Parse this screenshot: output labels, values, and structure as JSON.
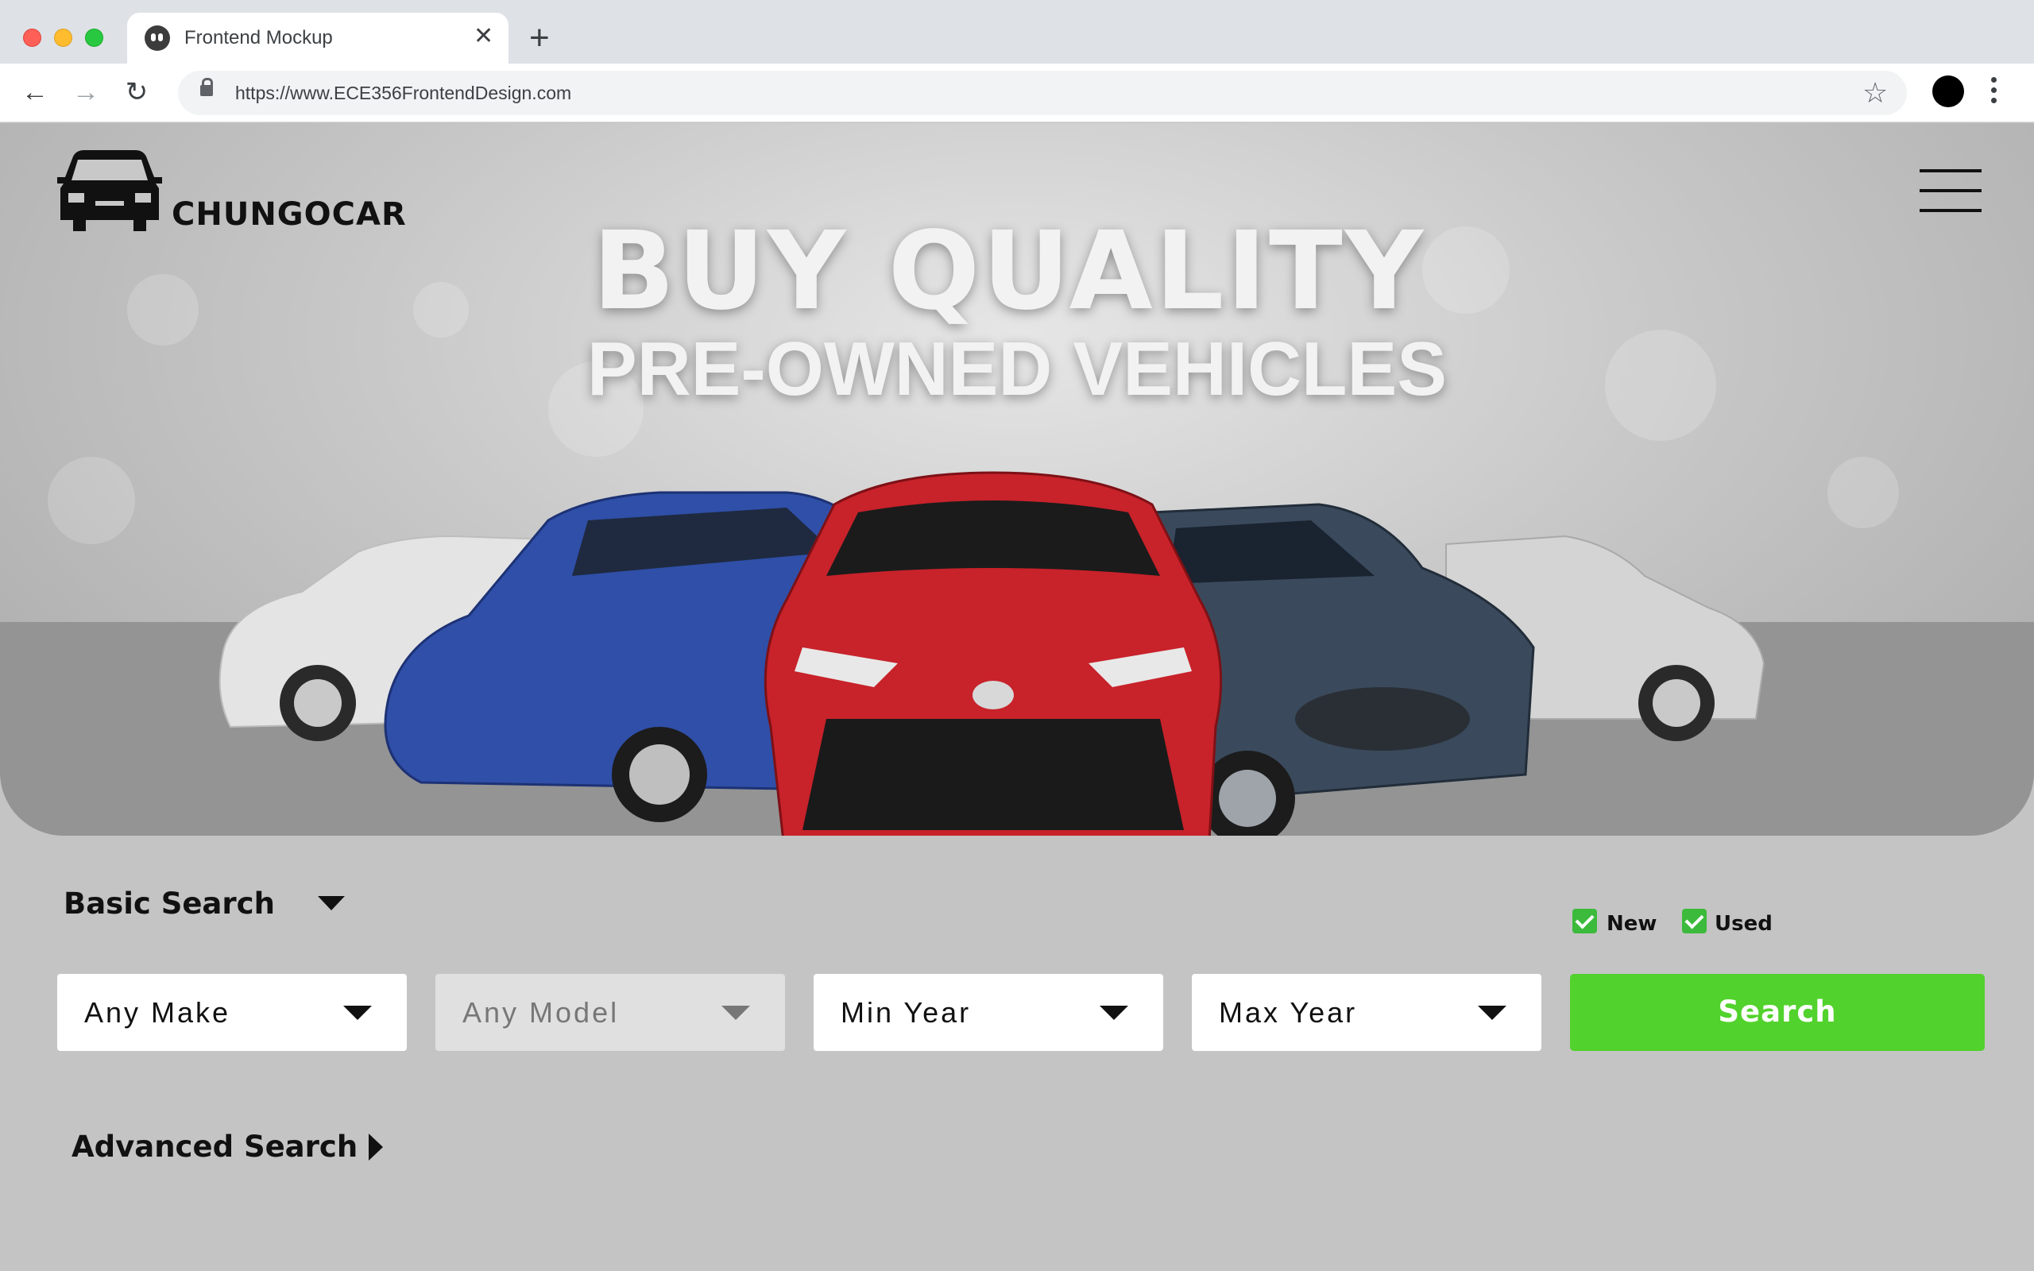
{
  "browser": {
    "tab_title": "Frontend Mockup",
    "tab_close": "✕",
    "new_tab": "+",
    "url": "https://www.ECE356FrontendDesign.com",
    "back": "←",
    "forward": "→",
    "reload": "↻",
    "star": "☆"
  },
  "hero": {
    "brand": "CHUNGOCAR",
    "headline_line1": "BUY QUALITY",
    "headline_line2": "PRE-OWNED VEHICLES"
  },
  "search": {
    "basic_label": "Basic Search",
    "advanced_label": "Advanced Search",
    "new_label": "New",
    "used_label": "Used",
    "new_checked": true,
    "used_checked": true,
    "make": "Any Make",
    "model": "Any Model",
    "min_year": "Min Year",
    "max_year": "Max Year",
    "button": "Search",
    "accent_color": "#52d22c"
  }
}
